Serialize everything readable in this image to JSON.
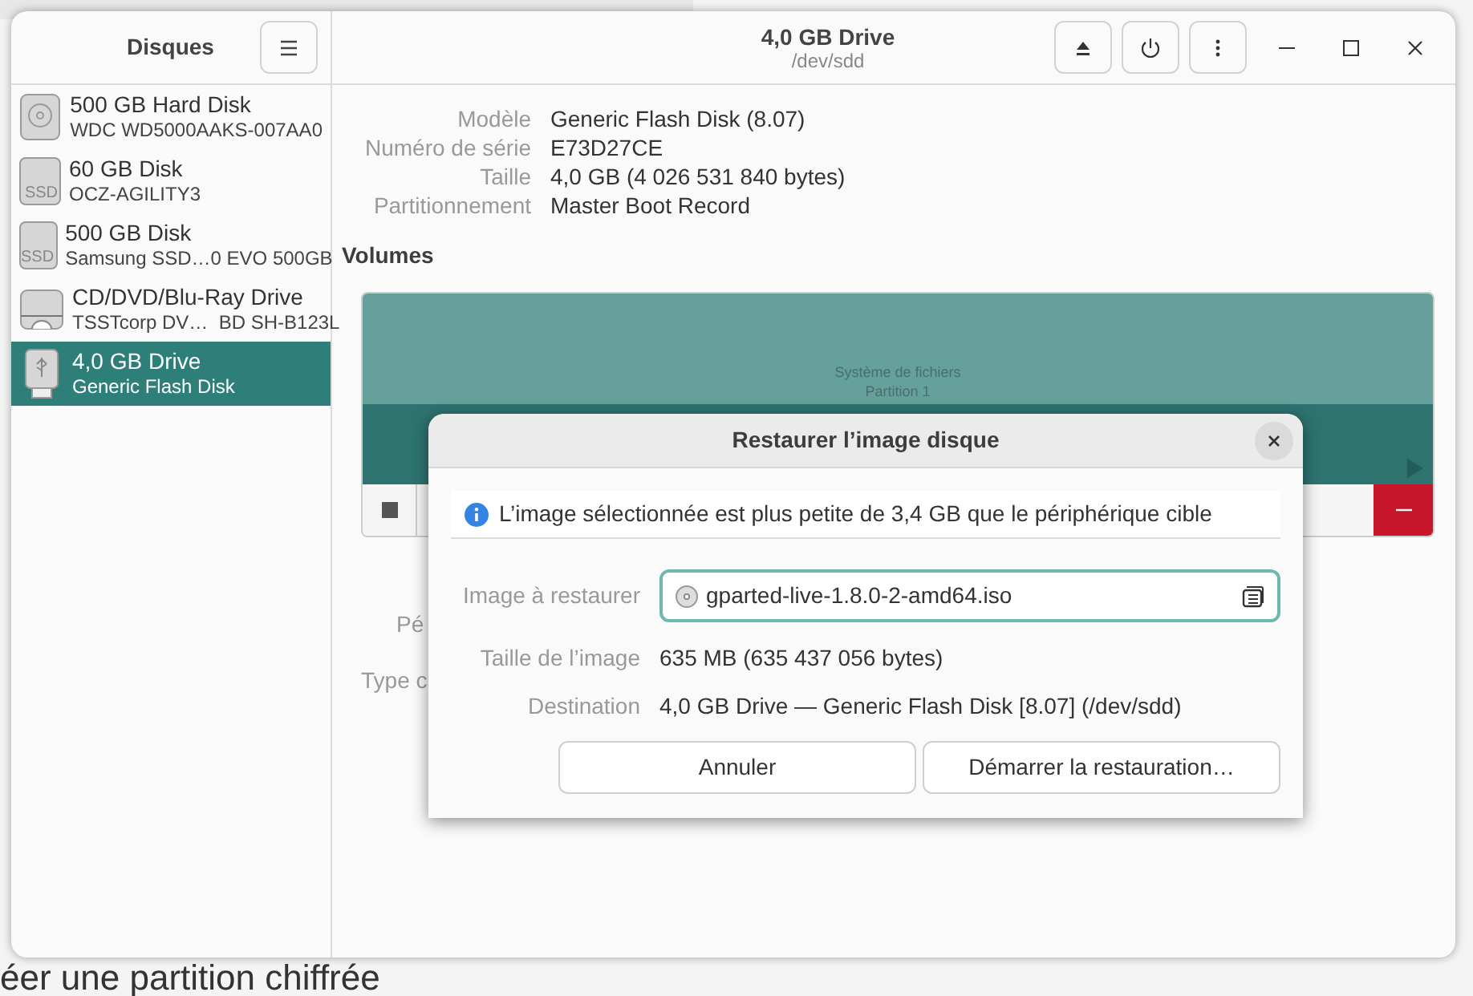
{
  "background": {
    "bottom_heading": "éer une partition chiffrée"
  },
  "window": {
    "sidebar_title": "Disques",
    "title": "4,0 GB Drive",
    "subtitle": "/dev/sdd"
  },
  "drives": [
    {
      "kind": "hdd",
      "name": "500 GB Hard Disk",
      "model": "WDC WD5000AAKS-007AA0",
      "selected": false
    },
    {
      "kind": "ssd",
      "badge": "SSD",
      "name": "60 GB Disk",
      "model": "OCZ-AGILITY3",
      "selected": false
    },
    {
      "kind": "ssd",
      "badge": "SSD",
      "name": "500 GB Disk",
      "model": "Samsung SSD…0 EVO 500GB",
      "selected": false
    },
    {
      "kind": "optical",
      "name": "CD/DVD/Blu-Ray Drive",
      "model": "TSSTcorp DV…  BD SH-B123L",
      "selected": false
    },
    {
      "kind": "usb",
      "name": "4,0 GB Drive",
      "model": "Generic Flash Disk",
      "selected": true
    }
  ],
  "details": [
    {
      "label": "Modèle",
      "value": "Generic Flash Disk (8.07)"
    },
    {
      "label": "Numéro de série",
      "value": "E73D27CE"
    },
    {
      "label": "Taille",
      "value": "4,0 GB (4 026 531 840 bytes)"
    },
    {
      "label": "Partitionnement",
      "value": "Master Boot Record"
    }
  ],
  "volumes": {
    "heading": "Volumes",
    "partition_lines": [
      "Système de fichiers",
      "Partition 1"
    ]
  },
  "obscured_labels": [
    "Pé",
    "Type c"
  ],
  "dialog": {
    "title": "Restaurer l’image disque",
    "info": "L’image sélectionnée est plus petite de 3,4 GB que le périphérique cible",
    "image_label": "Image à restaurer",
    "image_value": "gparted-live-1.8.0-2-amd64.iso",
    "rows": [
      {
        "label": "Taille de l’image",
        "value": "635 MB (635 437 056 bytes)"
      },
      {
        "label": "Destination",
        "value": "4,0 GB Drive — Generic Flash Disk [8.07] (/dev/sdd)"
      }
    ],
    "buttons": [
      "Annuler",
      "Démarrer la restauration…"
    ]
  }
}
